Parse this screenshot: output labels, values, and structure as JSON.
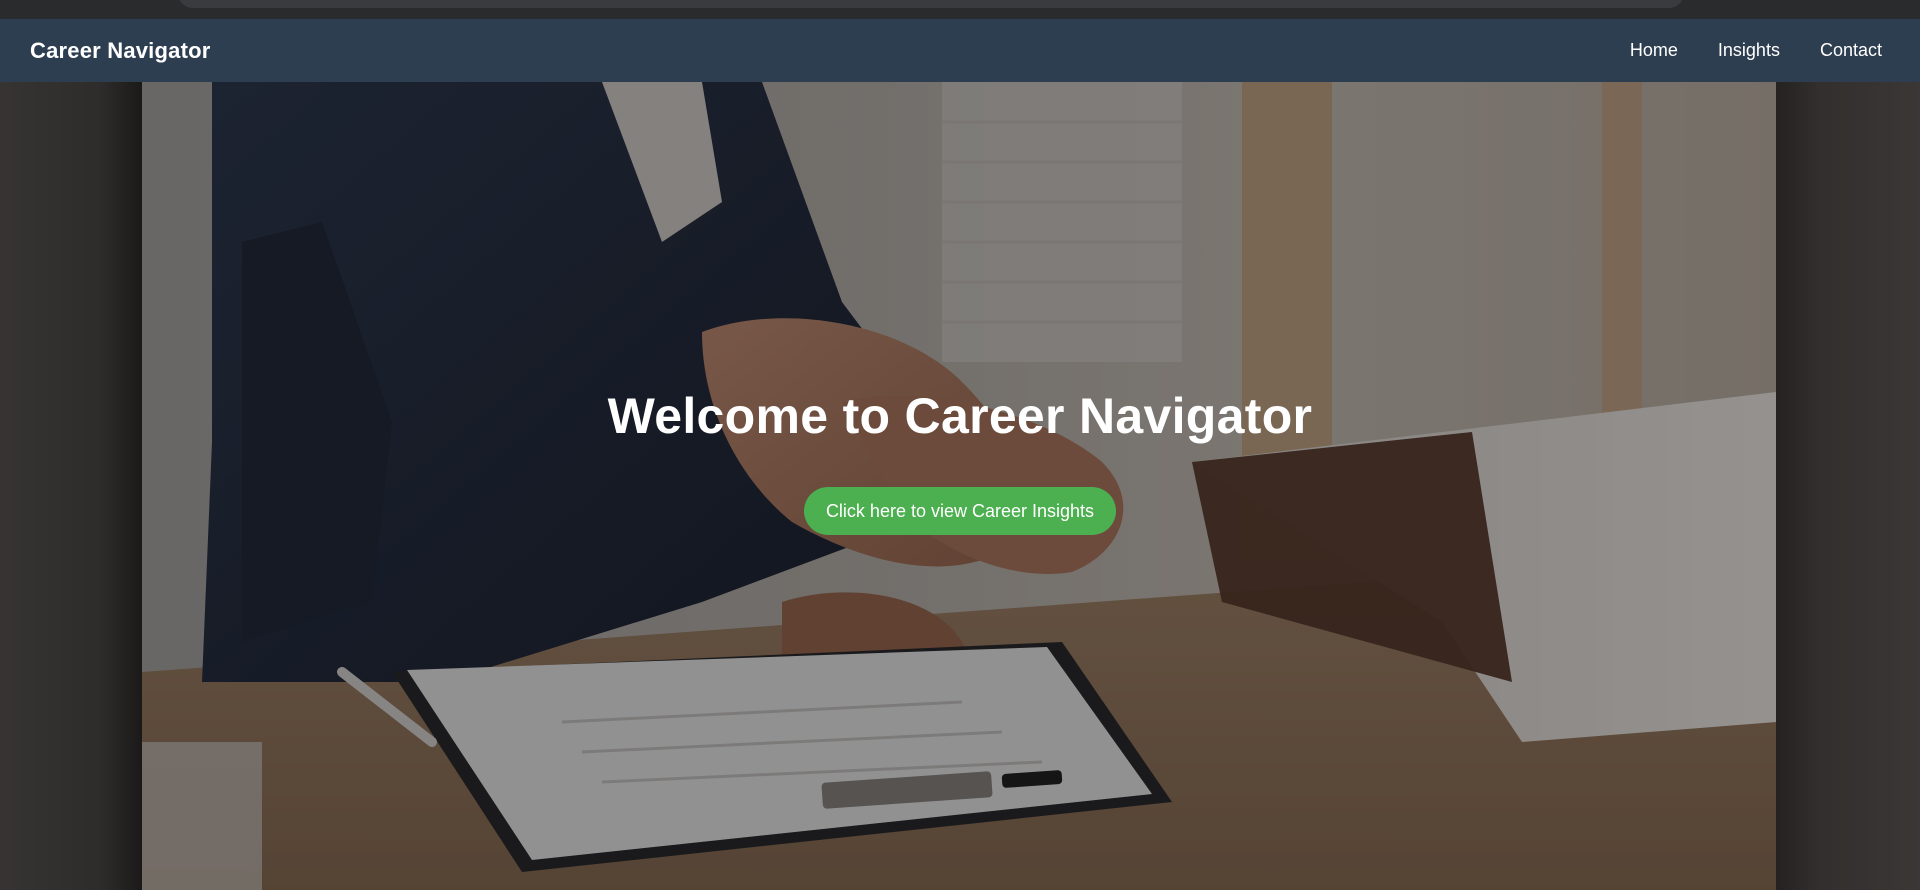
{
  "navbar": {
    "brand": "Career Navigator",
    "links": [
      {
        "label": "Home"
      },
      {
        "label": "Insights"
      },
      {
        "label": "Contact"
      }
    ]
  },
  "hero": {
    "title": "Welcome to Career Navigator",
    "cta_label": "Click here to view Career Insights",
    "background_image": "business-handshake-photo",
    "overlay_color": "#000000"
  },
  "colors": {
    "navbar_bg": "#2d3e50",
    "cta_bg": "#4caf50",
    "text": "#ffffff"
  }
}
